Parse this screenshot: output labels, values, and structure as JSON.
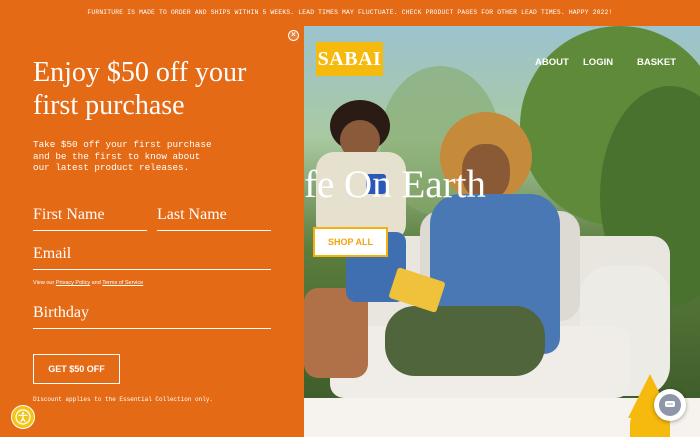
{
  "announcement": "FURNITURE IS MADE TO ORDER AND SHIPS WITHIN 5 WEEKS. LEAD TIMES MAY FLUCTUATE. CHECK PRODUCT PAGES FOR OTHER LEAD TIMES. HAPPY 2022!",
  "brand": {
    "logo_text": "SABAI",
    "logo_color": "#f6b90e"
  },
  "nav": {
    "about": "ABOUT",
    "login": "LOGIN",
    "basket": "BASKET"
  },
  "hero": {
    "title_fragment": "fe On Earth",
    "shop_all": "SHOP ALL"
  },
  "popup": {
    "background": "#e46a16",
    "close_icon": "close-icon",
    "heading": "Enjoy $50 off your first purchase",
    "description": "Take $50 off your first purchase and be the first to know about our latest product releases.",
    "first_name_placeholder": "First Name",
    "last_name_placeholder": "Last Name",
    "email_placeholder": "Email",
    "view_note_prefix": "View our",
    "privacy_link": "Privacy Policy",
    "view_note_and": "and",
    "terms_link": "Terms of Service",
    "birthday_placeholder": "Birthday",
    "submit_label": "GET $50 OFF",
    "fine_print": "Discount applies to the Essential Collection only."
  },
  "widgets": {
    "accessibility_icon": "accessibility-icon",
    "chat_icon": "chat-icon"
  }
}
